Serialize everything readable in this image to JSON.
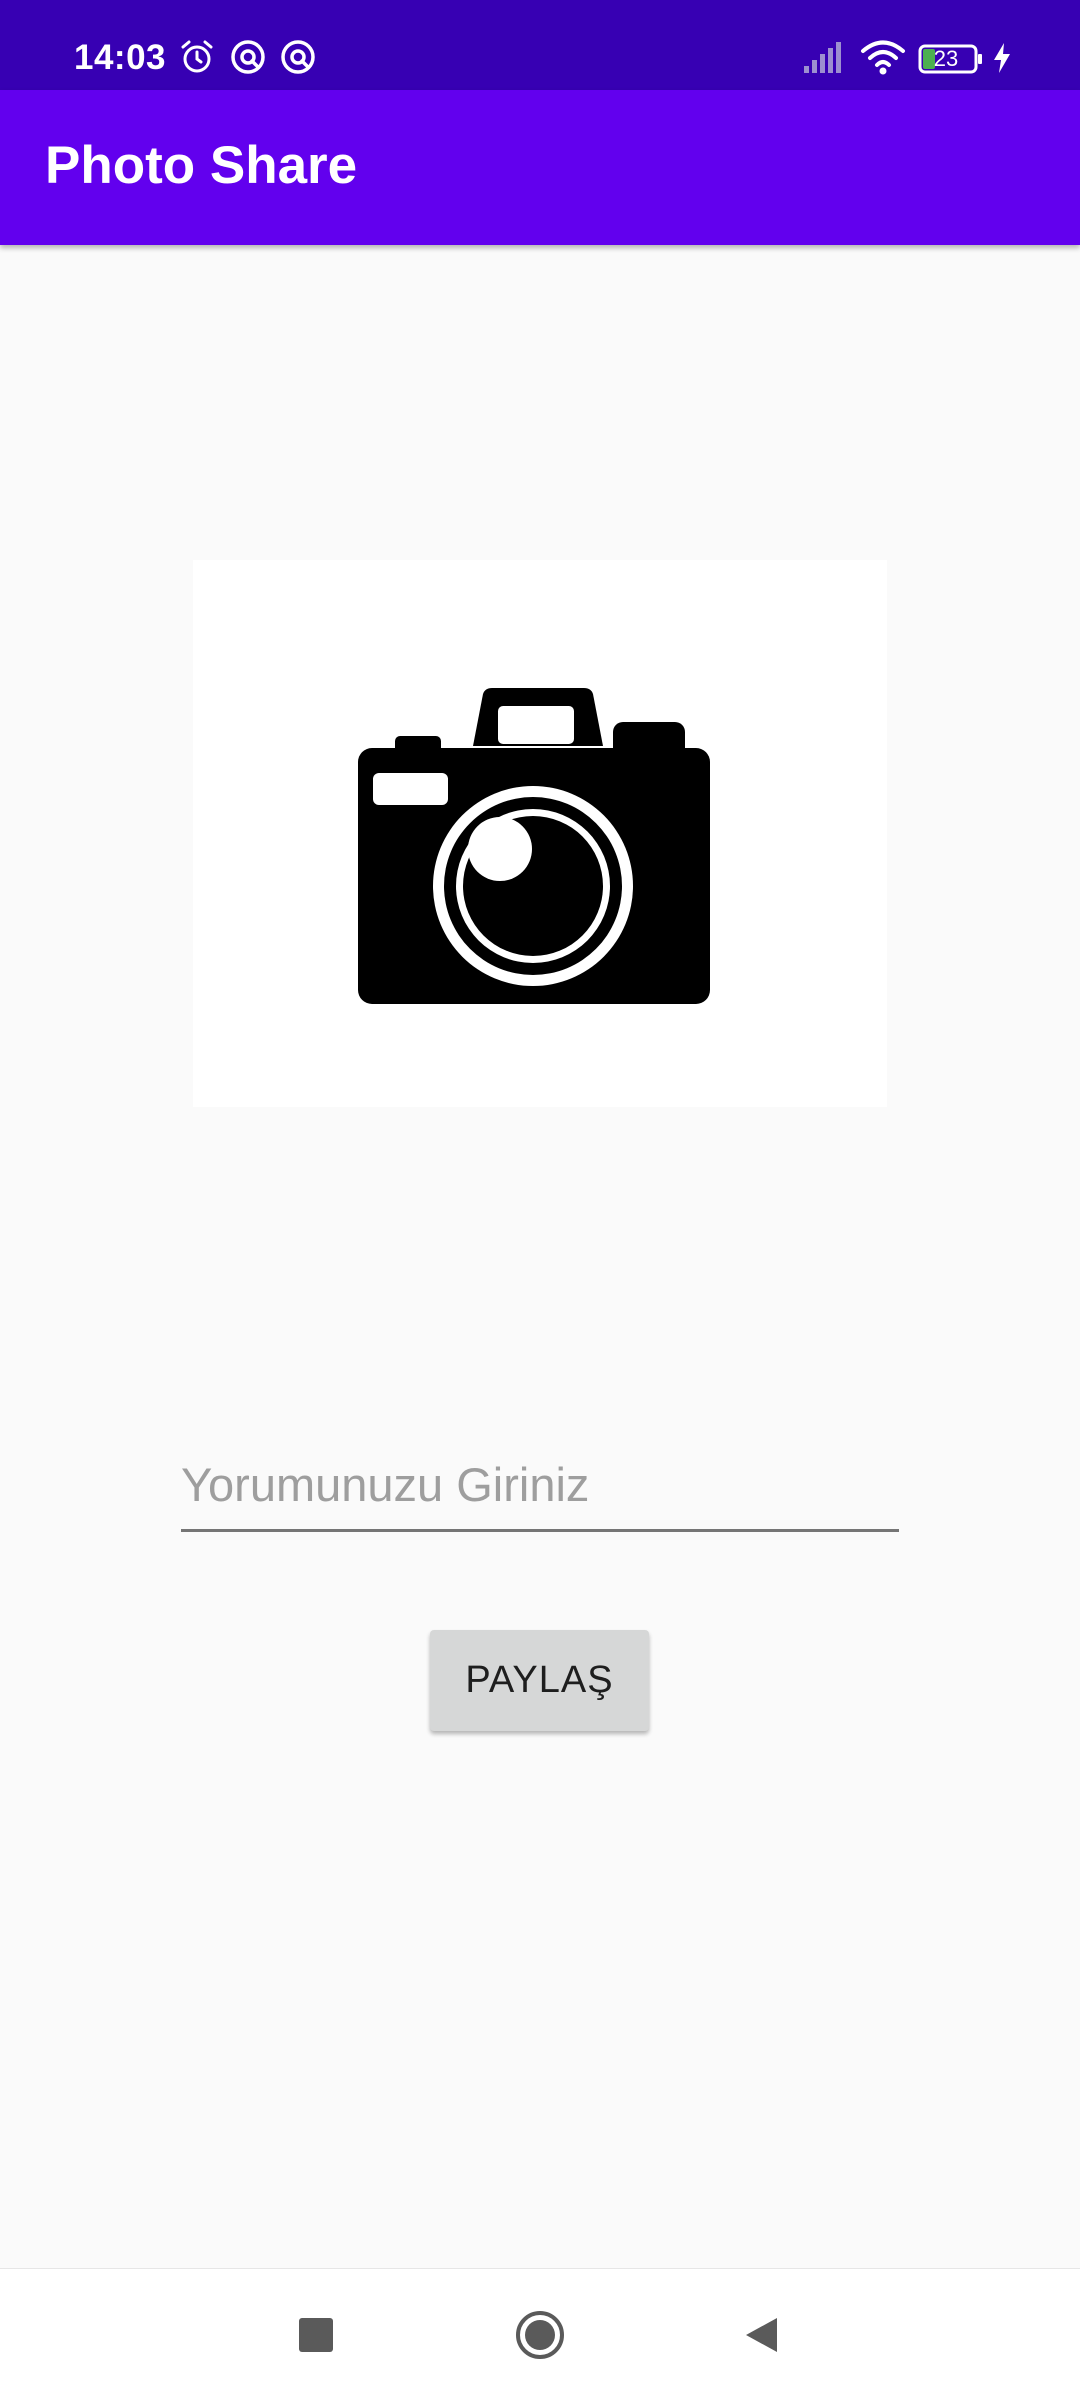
{
  "status_bar": {
    "time": "14:03",
    "battery_level": "23",
    "icons": [
      "alarm-icon",
      "app-notification-icon",
      "app-notification-icon",
      "signal-icon",
      "wifi-icon",
      "battery-icon",
      "charging-icon"
    ]
  },
  "app_bar": {
    "title": "Photo Share"
  },
  "photo": {
    "icon": "camera-icon"
  },
  "comment": {
    "placeholder": "Yorumunuzu Giriniz",
    "value": ""
  },
  "share_button": {
    "label": "PAYLAŞ"
  },
  "nav_bar": {
    "icons": [
      "recent-apps-icon",
      "home-icon",
      "back-icon"
    ]
  },
  "colors": {
    "status_bar": "#3700b3",
    "app_bar": "#6200ee",
    "background": "#fafafa",
    "button": "#d6d7d7"
  }
}
